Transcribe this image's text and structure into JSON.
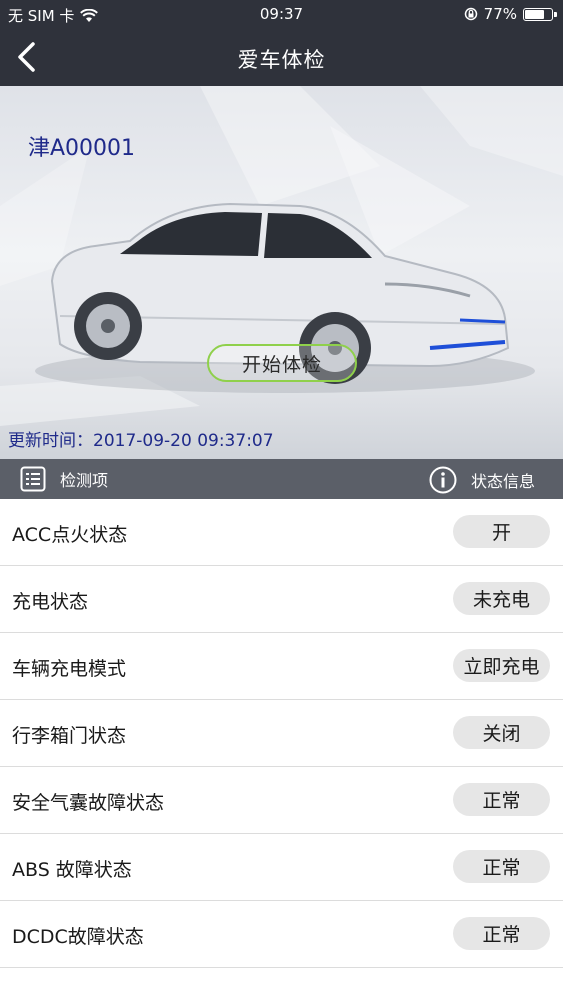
{
  "status_bar": {
    "carrier": "无 SIM 卡",
    "time": "09:37",
    "battery": "77%",
    "battery_level": 0.77
  },
  "nav": {
    "title": "爱车体检"
  },
  "hero": {
    "plate": "津A00001",
    "start_button": "开始体检",
    "update_time": "更新时间：2017-09-20 09:37:07"
  },
  "table_header": {
    "left": "检测项",
    "right": "状态信息"
  },
  "items": [
    {
      "label": "ACC点火状态",
      "status": "开"
    },
    {
      "label": "充电状态",
      "status": "未充电"
    },
    {
      "label": "车辆充电模式",
      "status": "立即充电"
    },
    {
      "label": "行李箱门状态",
      "status": "关闭"
    },
    {
      "label": "安全气囊故障状态",
      "status": "正常"
    },
    {
      "label": "ABS 故障状态",
      "status": "正常"
    },
    {
      "label": "DCDC故障状态",
      "status": "正常"
    }
  ]
}
